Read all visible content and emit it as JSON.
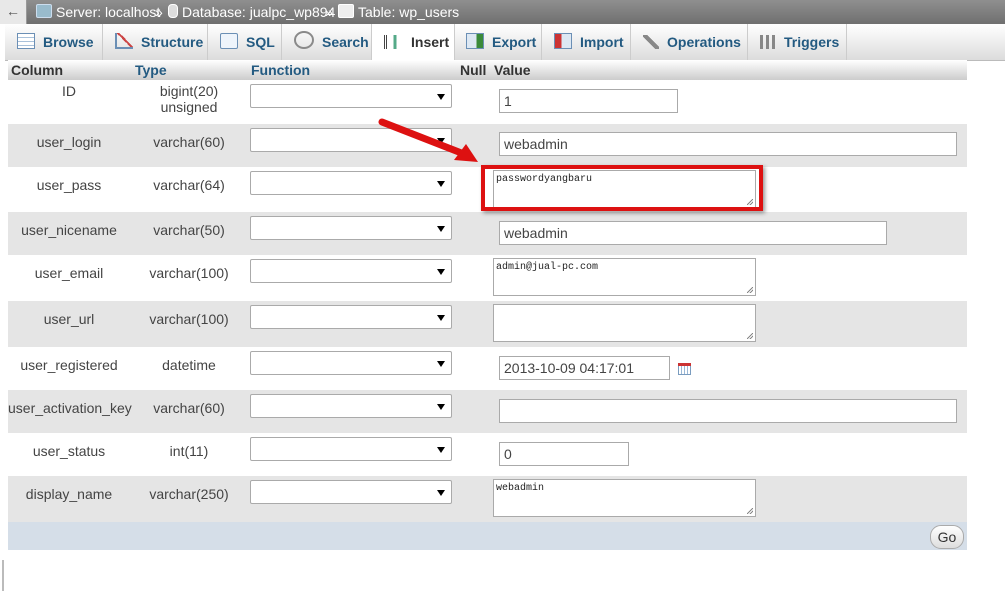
{
  "breadcrumb": {
    "back": "←",
    "server": "Server: localhost",
    "database": "Database: jualpc_wp894",
    "table": "Table: wp_users",
    "separator": "»"
  },
  "tabs": [
    {
      "label": "Browse",
      "icon": "browse-icon"
    },
    {
      "label": "Structure",
      "icon": "structure-icon"
    },
    {
      "label": "SQL",
      "icon": "sql-icon"
    },
    {
      "label": "Search",
      "icon": "search-icon"
    },
    {
      "label": "Insert",
      "icon": "insert-icon",
      "active": true
    },
    {
      "label": "Export",
      "icon": "export-icon"
    },
    {
      "label": "Import",
      "icon": "import-icon"
    },
    {
      "label": "Operations",
      "icon": "operations-icon"
    },
    {
      "label": "Triggers",
      "icon": "triggers-icon"
    }
  ],
  "table": {
    "headers": {
      "column": "Column",
      "type": "Type",
      "function": "Function",
      "null": "Null",
      "value": "Value"
    },
    "rows": [
      {
        "column": "ID",
        "type": "bigint(20) unsigned",
        "value": "1",
        "input": "text"
      },
      {
        "column": "user_login",
        "type": "varchar(60)",
        "value": "webadmin",
        "input": "text"
      },
      {
        "column": "user_pass",
        "type": "varchar(64)",
        "value": "passwordyangbaru",
        "input": "textarea"
      },
      {
        "column": "user_nicename",
        "type": "varchar(50)",
        "value": "webadmin",
        "input": "text"
      },
      {
        "column": "user_email",
        "type": "varchar(100)",
        "value": "admin@jual-pc.com",
        "input": "textarea"
      },
      {
        "column": "user_url",
        "type": "varchar(100)",
        "value": "",
        "input": "textarea"
      },
      {
        "column": "user_registered",
        "type": "datetime",
        "value": "2013-10-09 04:17:01",
        "input": "text"
      },
      {
        "column": "user_activation_key",
        "type": "varchar(60)",
        "value": "",
        "input": "text"
      },
      {
        "column": "user_status",
        "type": "int(11)",
        "value": "0",
        "input": "text"
      },
      {
        "column": "display_name",
        "type": "varchar(250)",
        "value": "webadmin",
        "input": "textarea"
      }
    ]
  },
  "go_button": "Go",
  "colors": {
    "annotation": "#dd1111",
    "link": "#235a81",
    "row_alt": "#e5e5e5"
  }
}
